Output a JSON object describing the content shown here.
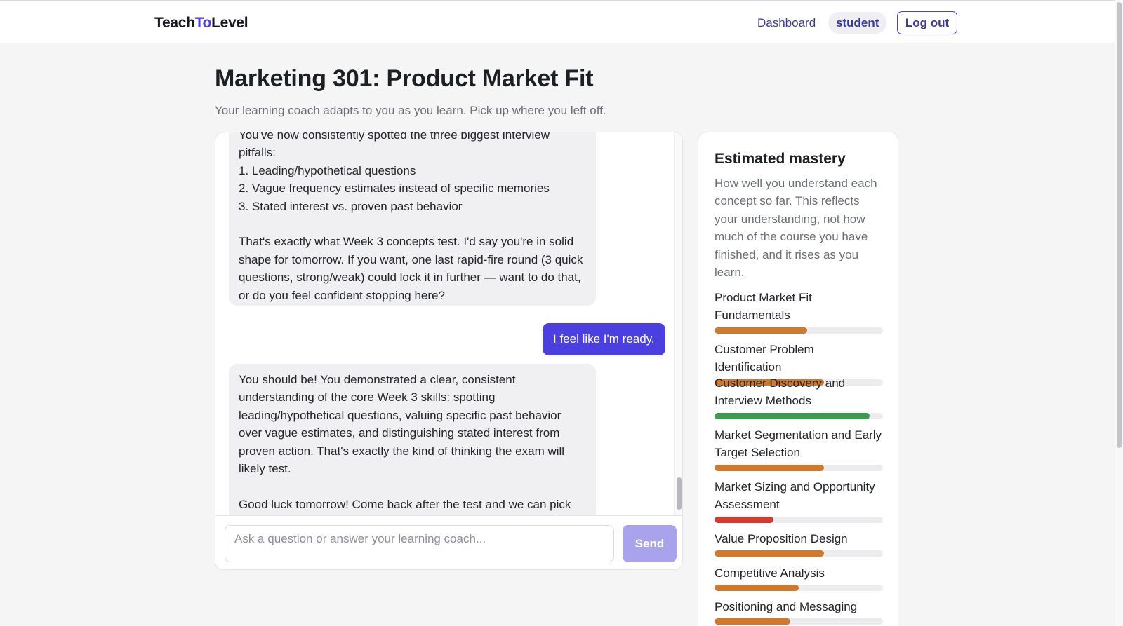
{
  "header": {
    "logo_part1": "Teach",
    "logo_part2": "To",
    "logo_part3": "Level",
    "nav_dashboard": "Dashboard",
    "user_label": "student",
    "logout_label": "Log out"
  },
  "page": {
    "title": "Marketing 301: Product Market Fit",
    "subtitle": "Your learning coach adapts to you as you learn. Pick up where you left off."
  },
  "chat": {
    "messages": [
      {
        "role": "coach",
        "text": "You've now consistently spotted the three biggest interview pitfalls:\n1. Leading/hypothetical questions\n2. Vague frequency estimates instead of specific memories\n3. Stated interest vs. proven past behavior\n\nThat's exactly what Week 3 concepts test. I'd say you're in solid shape for tomorrow. If you want, one last rapid-fire round (3 quick questions, strong/weak) could lock it in further — want to do that, or do you feel confident stopping here?"
      },
      {
        "role": "user",
        "text": "I feel like I'm ready."
      },
      {
        "role": "coach",
        "text": "You should be! You demonstrated a clear, consistent understanding of the core Week 3 skills: spotting leading/hypothetical questions, valuing specific past behavior over vague estimates, and distinguishing stated interest from proven action. That's exactly the kind of thinking the exam will likely test.\n\nGood luck tomorrow! Come back after the test and we can pick up with Market Sizing (TAM/SAM/SOM) or loop back to Segmentation"
      }
    ],
    "input_placeholder": "Ask a question or answer your learning coach...",
    "input_value": "",
    "send_label": "Send"
  },
  "mastery": {
    "title": "Estimated mastery",
    "description": "How well you understand each concept so far. This reflects your understanding, not how much of the course you have finished, and it rises as you learn.",
    "concepts": [
      {
        "label": "Product Market Fit Fundamentals",
        "level": 0.55,
        "color": "#d2782a"
      },
      {
        "label": "Customer Problem Identification",
        "level": 0.65,
        "color": "#d2782a"
      },
      {
        "label": "Customer Discovery and Interview Methods",
        "level": 0.92,
        "color": "#3f9a52"
      },
      {
        "label": "Market Segmentation and Early Target Selection",
        "level": 0.65,
        "color": "#d2782a"
      },
      {
        "label": "Market Sizing and Opportunity Assessment",
        "level": 0.35,
        "color": "#d43a2f"
      },
      {
        "label": "Value Proposition Design",
        "level": 0.65,
        "color": "#d2782a"
      },
      {
        "label": "Competitive Analysis",
        "level": 0.5,
        "color": "#d2782a"
      },
      {
        "label": "Positioning and Messaging",
        "level": 0.45,
        "color": "#d2782a"
      }
    ]
  },
  "colors": {
    "accent": "#4b3fe0",
    "send_disabled": "#a9a3ee"
  }
}
